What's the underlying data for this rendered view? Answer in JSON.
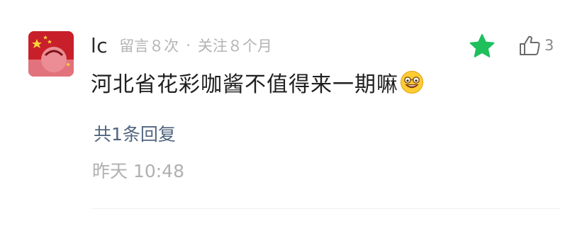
{
  "comment": {
    "username": "lc",
    "meta_messages": "留言８次",
    "meta_separator": "·",
    "meta_follow": "关注８个月",
    "content": "河北省花彩咖酱不值得来一期嘛",
    "emoji": "grinning-face-with-glasses",
    "like_count": "3",
    "reply_link": "共1条回复",
    "timestamp": "昨天 10:48"
  },
  "colors": {
    "star": "#1fbf5c",
    "username": "#2b2b2b",
    "meta": "#b3b3b3",
    "reply_link": "#51657f",
    "timestamp": "#b0b0b0",
    "avatar_bg": "#c8202a"
  },
  "icons": {
    "star": "star-icon",
    "like": "thumbs-up-icon",
    "emoji": "grinning-face-emoji-icon"
  }
}
